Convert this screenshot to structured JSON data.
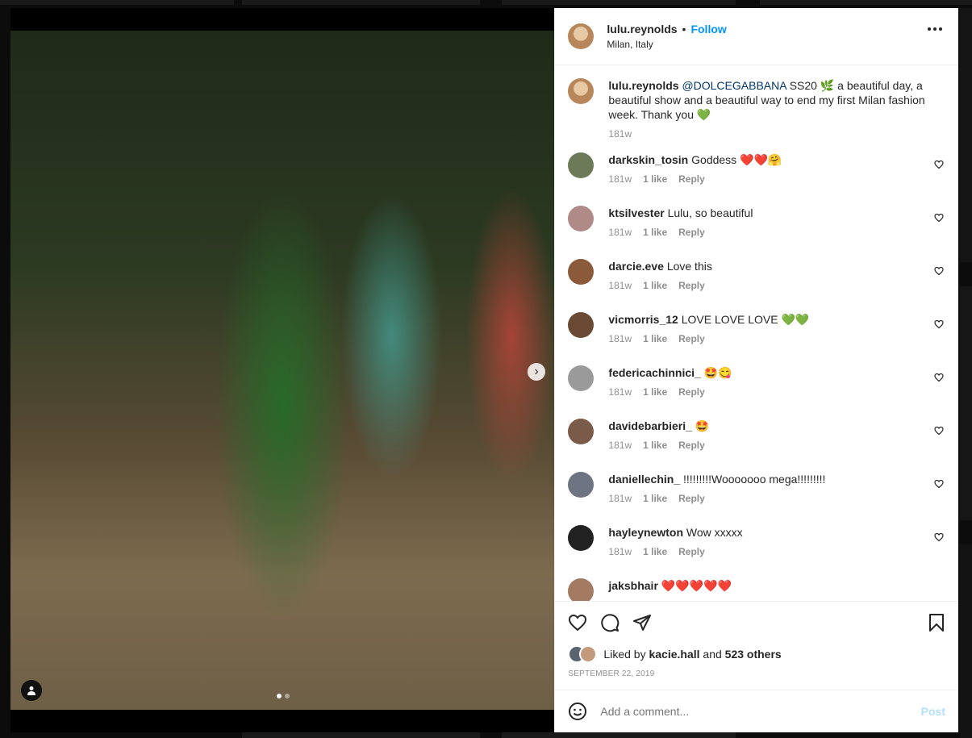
{
  "post": {
    "author": "lulu.reynolds",
    "separator": "•",
    "follow_label": "Follow",
    "location": "Milan, Italy",
    "caption": {
      "author": "lulu.reynolds",
      "mention": "@DOLCEGABBANA",
      "text": " SS20 🌿 a beautiful day, a beautiful show and a beautiful way to end my first Milan fashion week. Thank you 💚",
      "time": "181w"
    },
    "carousel": {
      "slide": 1,
      "total": 2
    }
  },
  "comments": [
    {
      "user": "darkskin_tosin",
      "text": "Goddess ❤️❤️🤗",
      "time": "181w",
      "likes": "1 like",
      "reply": "Reply",
      "avatar_color": "#6d7a5a"
    },
    {
      "user": "ktsilvester",
      "text": "Lulu, so beautiful",
      "time": "181w",
      "likes": "1 like",
      "reply": "Reply",
      "avatar_color": "#b08a86"
    },
    {
      "user": "darcie.eve",
      "text": "Love this",
      "time": "181w",
      "likes": "1 like",
      "reply": "Reply",
      "avatar_color": "#8a5a3a"
    },
    {
      "user": "vicmorris_12",
      "text": "LOVE LOVE LOVE 💚💚",
      "time": "181w",
      "likes": "1 like",
      "reply": "Reply",
      "avatar_color": "#6b4a35"
    },
    {
      "user": "federicachinnici_",
      "text": "🤩😋",
      "time": "181w",
      "likes": "1 like",
      "reply": "Reply",
      "avatar_color": "#9a9a9a"
    },
    {
      "user": "davidebarbieri_",
      "text": "🤩",
      "time": "181w",
      "likes": "1 like",
      "reply": "Reply",
      "avatar_color": "#7a5a48"
    },
    {
      "user": "daniellechin_",
      "text": "!!!!!!!!!Wooooooo mega!!!!!!!!!",
      "time": "181w",
      "likes": "1 like",
      "reply": "Reply",
      "avatar_color": "#6e7482"
    },
    {
      "user": "hayleynewton",
      "text": "Wow xxxxx",
      "time": "181w",
      "likes": "1 like",
      "reply": "Reply",
      "avatar_color": "#222222"
    },
    {
      "user": "jaksbhair",
      "text": "❤️❤️❤️❤️❤️",
      "time": "",
      "likes": "",
      "reply": "",
      "avatar_color": "#a57a62"
    }
  ],
  "footer": {
    "liked_prefix": "Liked by ",
    "liked_user": "kacie.hall",
    "liked_suffix": " and ",
    "liked_others": "523 others",
    "date": "SEPTEMBER 22, 2019",
    "comment_placeholder": "Add a comment...",
    "post_label": "Post"
  },
  "colors": {
    "accent": "#0095f6",
    "post_disabled": "#b2dffc",
    "mention": "#00376b"
  }
}
